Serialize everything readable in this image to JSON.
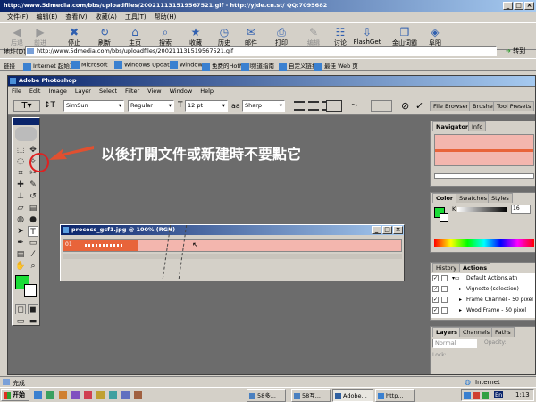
{
  "browser": {
    "title": "http://www.5dmedia.com/bbs/uploadfiles/200211131519567521.gif - http://yjde.cn.st/ QQ:7095682",
    "menu": [
      "文件(F)",
      "编辑(E)",
      "查看(V)",
      "收藏(A)",
      "工具(T)",
      "帮助(H)"
    ],
    "toolbar": [
      {
        "label": "后退",
        "icon": "back-arrow-icon",
        "enabled": false
      },
      {
        "label": "前进",
        "icon": "forward-arrow-icon",
        "enabled": false
      },
      {
        "label": "停止",
        "icon": "stop-icon",
        "enabled": true
      },
      {
        "label": "刷新",
        "icon": "refresh-icon",
        "enabled": true
      },
      {
        "label": "主页",
        "icon": "home-icon",
        "enabled": true
      },
      {
        "label": "搜索",
        "icon": "search-icon",
        "enabled": true
      },
      {
        "label": "收藏",
        "icon": "favorites-icon",
        "enabled": true
      },
      {
        "label": "历史",
        "icon": "history-icon",
        "enabled": true
      },
      {
        "label": "邮件",
        "icon": "mail-icon",
        "enabled": true
      },
      {
        "label": "打印",
        "icon": "print-icon",
        "enabled": true
      },
      {
        "label": "编辑",
        "icon": "edit-icon",
        "enabled": false
      },
      {
        "label": "讨论",
        "icon": "discuss-icon",
        "enabled": true
      },
      {
        "label": "FlashGet",
        "icon": "flashget-icon",
        "enabled": true
      },
      {
        "label": "金山词霸",
        "icon": "dictionary-icon",
        "enabled": true
      },
      {
        "label": "阜阳",
        "icon": "link-icon",
        "enabled": true
      }
    ],
    "address_label": "地址(D)",
    "address_value": "http://www.5dmedia.com/bbs/uploadfiles/200211131519567521.gif",
    "go_label": "转到",
    "links_label": "链接",
    "links": [
      "Internet 起始页",
      "Microsoft",
      "Windows Update",
      "Windows",
      "免费的HotMail",
      "频道指南",
      "自定义链接",
      "最佳 Web 页"
    ],
    "status_text": "完成",
    "zone_text": "Internet"
  },
  "photoshop": {
    "title": "Adobe Photoshop",
    "menu": [
      "File",
      "Edit",
      "Image",
      "Layer",
      "Select",
      "Filter",
      "View",
      "Window",
      "Help"
    ],
    "options": {
      "font": "SimSun",
      "style": "Regular",
      "size": "12 pt",
      "aa": "Sharp"
    },
    "palette_tabs": [
      "File Browser",
      "Brushes",
      "Tool Presets"
    ],
    "navigator_tabs": [
      "Navigator",
      "Info"
    ],
    "color_tabs": [
      "Color",
      "Swatches",
      "Styles"
    ],
    "color_channel": "K",
    "color_value": "16",
    "history_tabs": [
      "History",
      "Actions"
    ],
    "actions": [
      {
        "label": "Default Actions.atn",
        "check": "✓",
        "type": "folder"
      },
      {
        "label": "Vignette (selection)",
        "check": "✓",
        "type": "item"
      },
      {
        "label": "Frame Channel - 50 pixel",
        "check": "✓",
        "type": "item"
      },
      {
        "label": "Wood Frame - 50 pixel",
        "check": "✓",
        "type": "item"
      }
    ],
    "layers_tabs": [
      "Layers",
      "Channels",
      "Paths"
    ],
    "blend_mode": "Normal",
    "opacity_label": "Opacity:",
    "lock_label": "Lock:",
    "doc_title": "process_gcf1.jpg @ 100% (RGB)",
    "doc_frame_label": "01",
    "colors": {
      "foreground": "#1adc37",
      "accent": "#0a246a",
      "doc_fill": "#f3b6ae"
    }
  },
  "annotation": {
    "text": "以後打開文件或新建時不要點它"
  },
  "taskbar": {
    "start_label": "开始",
    "tasks": [
      "58多...",
      "58互...",
      "Adobe...",
      "http..."
    ],
    "clock": "1:13",
    "ime": "En"
  }
}
